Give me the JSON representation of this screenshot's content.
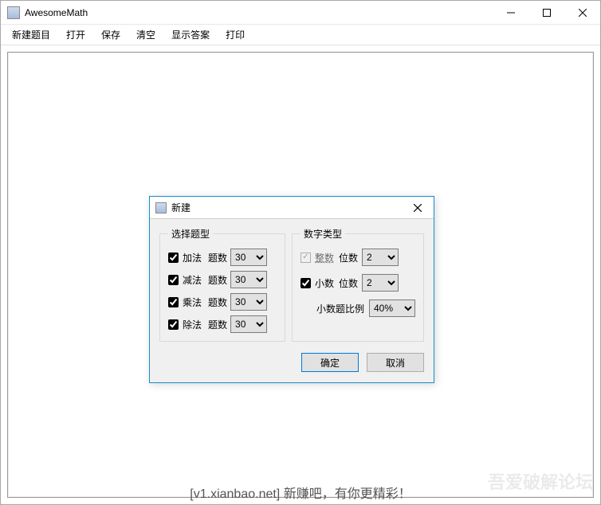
{
  "window": {
    "title": "AwesomeMath"
  },
  "menu": {
    "items": [
      "新建题目",
      "打开",
      "保存",
      "清空",
      "显示答案",
      "打印"
    ]
  },
  "dialog": {
    "title": "新建",
    "group_type": {
      "legend": "选择题型",
      "count_label": "题数",
      "rows": [
        {
          "label": "加法",
          "checked": true,
          "count": "30"
        },
        {
          "label": "减法",
          "checked": true,
          "count": "30"
        },
        {
          "label": "乘法",
          "checked": true,
          "count": "30"
        },
        {
          "label": "除法",
          "checked": true,
          "count": "30"
        }
      ]
    },
    "group_num": {
      "legend": "数字类型",
      "integer": {
        "label": "整数",
        "checked": true,
        "enabled": false,
        "digits_label": "位数",
        "digits": "2"
      },
      "decimal": {
        "label": "小数",
        "checked": true,
        "enabled": true,
        "digits_label": "位数",
        "digits": "2"
      },
      "ratio": {
        "label": "小数题比例",
        "value": "40%"
      }
    },
    "ok": "确定",
    "cancel": "取消"
  },
  "watermark": {
    "faint": "吾爱破解论坛",
    "main": "[v1.xianbao.net] 新赚吧，有你更精彩！"
  }
}
